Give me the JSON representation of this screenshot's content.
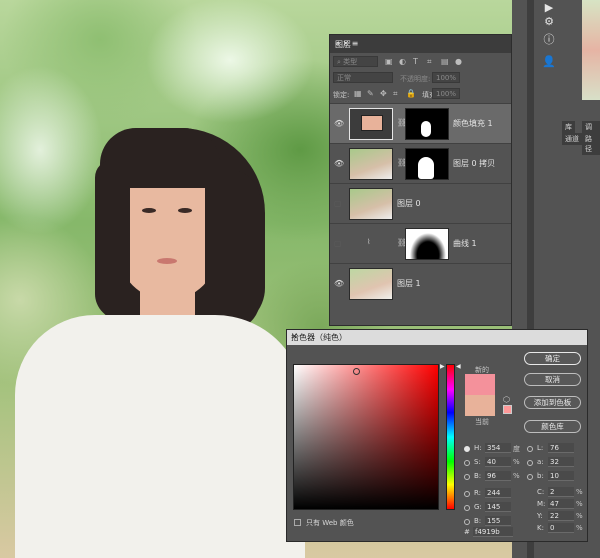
{
  "layers_panel": {
    "title": "图层",
    "filter_placeholder": "类型",
    "blend_mode": "正常",
    "opacity_label": "不透明度:",
    "opacity_value": "100%",
    "lock_label": "锁定:",
    "fill_label": "填充:",
    "fill_value": "100%",
    "layers": [
      {
        "name": "颜色填充 1",
        "visible": true,
        "selected": true
      },
      {
        "name": "图层 0 拷贝",
        "visible": true,
        "selected": false
      },
      {
        "name": "图层 0",
        "visible": false,
        "selected": false
      },
      {
        "name": "曲线 1",
        "visible": false,
        "selected": false
      },
      {
        "name": "图层 1",
        "visible": true,
        "selected": false
      }
    ]
  },
  "right_panel": {
    "tab_library": "库",
    "tab_adjust": "调整",
    "tab_channels": "通道",
    "tab_paths": "路径"
  },
  "color_picker": {
    "title": "拾色器（纯色）",
    "new_label": "新的",
    "current_label": "当前",
    "ok_button": "确定",
    "cancel_button": "取消",
    "add_swatch_button": "添加到色板",
    "color_library_button": "颜色库",
    "web_only_label": "只有 Web 颜色",
    "new_color": "#f4919b",
    "current_color": "#e8b29a",
    "hex_label": "#",
    "hex_value": "f4919b",
    "fields": {
      "H": {
        "label": "H:",
        "value": "354",
        "unit": "度"
      },
      "S": {
        "label": "S:",
        "value": "40",
        "unit": "%"
      },
      "B": {
        "label": "B:",
        "value": "96",
        "unit": "%"
      },
      "R": {
        "label": "R:",
        "value": "244"
      },
      "G": {
        "label": "G:",
        "value": "145"
      },
      "Bb": {
        "label": "B:",
        "value": "155"
      },
      "L": {
        "label": "L:",
        "value": "76"
      },
      "a": {
        "label": "a:",
        "value": "32"
      },
      "b": {
        "label": "b:",
        "value": "10"
      },
      "C": {
        "label": "C:",
        "value": "2",
        "unit": "%"
      },
      "M": {
        "label": "M:",
        "value": "47",
        "unit": "%"
      },
      "Y": {
        "label": "Y:",
        "value": "22",
        "unit": "%"
      },
      "K": {
        "label": "K:",
        "value": "0",
        "unit": "%"
      }
    }
  }
}
